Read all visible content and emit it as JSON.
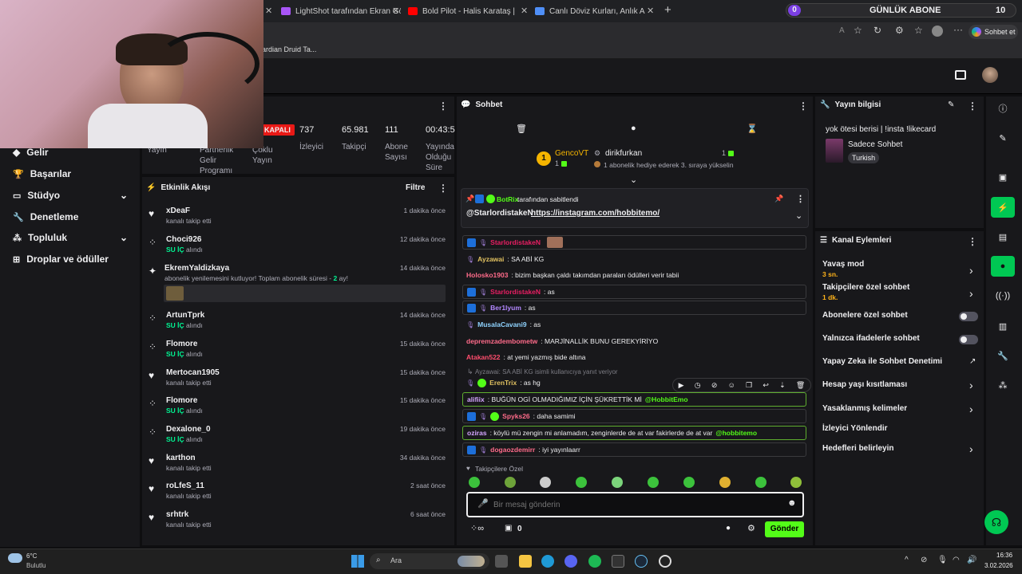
{
  "browser": {
    "tabs": [
      {
        "title": "LightShot tarafından Ekran Görünt",
        "color": "#a855f7"
      },
      {
        "title": "Bold Pilot - Halis Karataş | 1996 G",
        "color": "#ff0000"
      },
      {
        "title": "Canlı Döviz Kurları, Anlık Altın Fiya",
        "color": "#4f8ff7"
      }
    ],
    "new_tab": "+",
    "sub_goal": {
      "current": "0",
      "label": "GÜNLÜK ABONE",
      "target": "10"
    },
    "chat_button": "Sohbet et",
    "bookmark": "ardian Druid Ta..."
  },
  "nav": {
    "items": [
      {
        "label": "Gelir",
        "icon": "gem"
      },
      {
        "label": "Başarılar",
        "icon": "trophy"
      },
      {
        "label": "Stüdyo",
        "icon": "studio"
      },
      {
        "label": "Denetleme",
        "icon": "wrench"
      },
      {
        "label": "Topluluk",
        "icon": "community"
      },
      {
        "label": "Droplar ve ödüller",
        "icon": "drops"
      }
    ]
  },
  "stats": {
    "live_badge": "KAPALI",
    "items": [
      {
        "label": "Yayın"
      },
      {
        "label": "Partnerlik Gelir Programı"
      },
      {
        "label": "Çoklu Yayın"
      },
      {
        "value": "737",
        "label": "İzleyici"
      },
      {
        "value": "65.981",
        "label": "Takipçi"
      },
      {
        "value": "111",
        "label": "Abone Sayısı"
      },
      {
        "value": "00:43:5",
        "label": "Yayında Olduğu Süre"
      }
    ]
  },
  "activity": {
    "title": "Etkinlik Akışı",
    "filter": "Filtre",
    "items": [
      {
        "name": "xDeaF",
        "sub": "kanalı takip etti",
        "time": "1 dakika önce",
        "icon": "heart"
      },
      {
        "name": "Choci926",
        "sub_green": "SU İÇ",
        "sub": " alındı",
        "time": "12 dakika önce",
        "icon": "points"
      },
      {
        "name": "EkremYaldizkaya",
        "sub": "abonelik yenilemesini kutluyor! Toplam abonelik süresi - ",
        "sub_green": "2",
        "sub2": " ay!",
        "time": "14 dakika önce",
        "icon": "star"
      },
      {
        "name": "ArtunTprk",
        "sub_green": "SU İÇ",
        "sub": " alındı",
        "time": "14 dakika önce",
        "icon": "points"
      },
      {
        "name": "Flomore",
        "sub_green": "SU İÇ",
        "sub": " alındı",
        "time": "15 dakika önce",
        "icon": "points"
      },
      {
        "name": "Mertocan1905",
        "sub": "kanalı takip etti",
        "time": "15 dakika önce",
        "icon": "heart"
      },
      {
        "name": "Flomore",
        "sub_green": "SU İÇ",
        "sub": " alındı",
        "time": "15 dakika önce",
        "icon": "points"
      },
      {
        "name": "Dexalone_0",
        "sub_green": "SU İÇ",
        "sub": " alındı",
        "time": "19 dakika önce",
        "icon": "points"
      },
      {
        "name": "karthon",
        "sub": "kanalı takip etti",
        "time": "34 dakika önce",
        "icon": "heart"
      },
      {
        "name": "roLfeS_11",
        "sub": "kanalı takip etti",
        "time": "2 saat önce",
        "icon": "heart"
      },
      {
        "name": "srhtrk",
        "sub": "kanalı takip etti",
        "time": "6 saat önce",
        "icon": "heart"
      }
    ]
  },
  "chat": {
    "title": "Sohbet",
    "gifter1": {
      "name": "GencoVT",
      "rank": "1",
      "count": "1"
    },
    "gifter2": {
      "name": "dirikfurkan",
      "count": "1",
      "note": "1 abonelik hediye ederek 3. sıraya yükselin"
    },
    "pinned": {
      "by": "BotRix",
      "label": " tarafından sabitlendi",
      "user": "@StarlordistakeN",
      "link": "https://instagram.com/hobbitemo/"
    },
    "messages": [
      {
        "user": "StarlordistakeN",
        "text": "",
        "color": "#e91e63",
        "style": "box"
      },
      {
        "user": "Ayzawai",
        "text": ": SA ABİ KG",
        "color": "#e0c060",
        "style": "plain"
      },
      {
        "user": "Holosko1903",
        "text": ": bizim başkan çaldı takımdan paraları ödülleri verir tabii",
        "color": "#ff6b8a",
        "style": "plain"
      },
      {
        "user": "StarlordistakeN",
        "text": ": as",
        "color": "#e91e63",
        "style": "box"
      },
      {
        "user": "Ber1lyum",
        "text": ": as",
        "color": "#b388ff",
        "style": "box"
      },
      {
        "user": "MusalaCavani9",
        "text": ": as",
        "color": "#8fd3ff",
        "style": "plain"
      },
      {
        "user": "depremzadembometw",
        "text": ": MARJİNALLİK BUNU GEREKYİRİYO",
        "color": "#ff6b8a",
        "style": "plain"
      },
      {
        "user": "Atakan522",
        "text": ": at yemi yazmış bide altına",
        "color": "#ff4d6d",
        "style": "plain"
      },
      {
        "reply": "Ayzawai: SA ABİ KG isimli kullanıcıya yanıt veriyor",
        "user": "ErenTrix",
        "text": ": as hg",
        "color": "#e0c060",
        "style": "plain"
      },
      {
        "user": "alifiix",
        "text": ": BUĞÜN OGİ OLMADIĞIMIZ İÇİN ŞÜKRETTİK Mİ ",
        "mention": "@HobbitEmo",
        "color": "#d4a6ff",
        "style": "green"
      },
      {
        "user": "Spyks26",
        "text": ": daha samimi",
        "color": "#ff6b8a",
        "style": "box"
      },
      {
        "user": "oziras",
        "text": ": köylü mü zengin mi anlamadım, zenginlerde de at var fakirlerde de at var ",
        "mention": "@hobbitemo",
        "color": "#d4a6ff",
        "style": "green"
      },
      {
        "user": "dogaozdemirr",
        "text": ": iyi yayınlaarr",
        "color": "#ff6b8a",
        "style": "box"
      }
    ],
    "followers_only": "Takipçilere Özel",
    "input_placeholder": "Bir mesaj gönderin",
    "points": "0",
    "send": "Gönder"
  },
  "stream_info": {
    "title": "Yayın bilgisi",
    "stream_title": "yok ötesi berisi | !insta !likecard",
    "category": "Sadece Sohbet",
    "tag": "Turkish"
  },
  "channel_actions": {
    "title": "Kanal Eylemleri",
    "rows": [
      {
        "label": "Yavaş mod",
        "sub": "3 sn.",
        "control": "chevron"
      },
      {
        "label": "Takipçilere özel sohbet",
        "sub": "1 dk.",
        "control": "chevron"
      },
      {
        "label": "Abonelere özel sohbet",
        "control": "toggle"
      },
      {
        "label": "Yalnızca ifadelerle sohbet",
        "control": "toggle"
      },
      {
        "label": "Yapay Zeka ile Sohbet Denetimi",
        "control": "external"
      },
      {
        "label": "Hesap yaşı kısıtlaması",
        "control": "chevron"
      },
      {
        "label": "Yasaklanmış kelimeler",
        "control": "chevron"
      },
      {
        "label": "İzleyici Yönlendir",
        "control": "none"
      },
      {
        "label": "Hedefleri belirleyin",
        "control": "chevron"
      }
    ]
  },
  "taskbar": {
    "weather_temp": "6°C",
    "weather_desc": "Bulutlu",
    "search": "Ara",
    "time": "16:36",
    "date": "3.02.2026"
  },
  "colors": {
    "accent": "#53fc18",
    "green_text": "#00f593",
    "twitch_purple": "#9146ff"
  }
}
